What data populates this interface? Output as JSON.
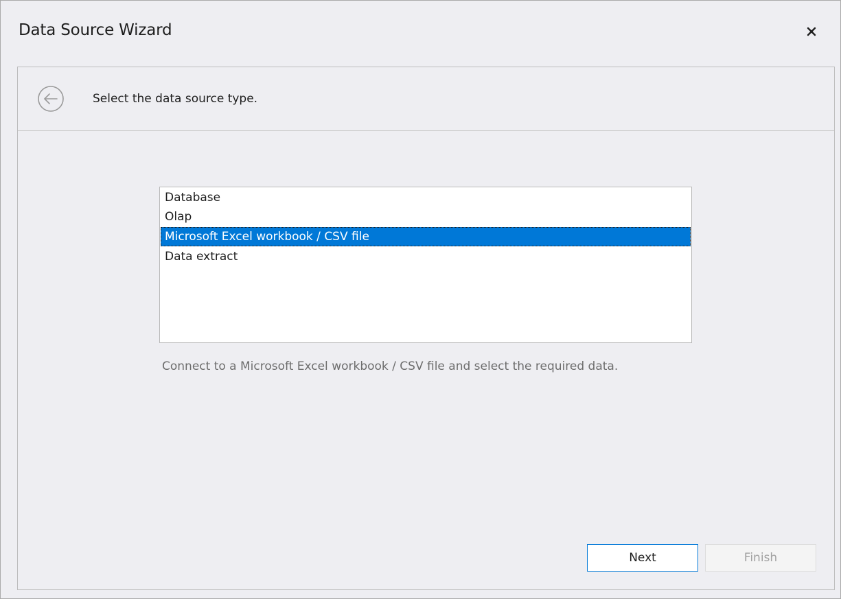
{
  "window": {
    "title": "Data Source Wizard"
  },
  "header": {
    "step_title": "Select the data source type."
  },
  "list": {
    "items": [
      {
        "label": "Database",
        "selected": false
      },
      {
        "label": "Olap",
        "selected": false
      },
      {
        "label": "Microsoft Excel workbook / CSV file",
        "selected": true
      },
      {
        "label": "Data extract",
        "selected": false
      }
    ]
  },
  "description": "Connect to a Microsoft Excel workbook / CSV file and select the required data.",
  "buttons": {
    "next_label": "Next",
    "finish_label": "Finish",
    "finish_enabled": false
  },
  "icons": {
    "close": "close-icon",
    "back": "back-arrow-icon"
  },
  "colors": {
    "selection": "#0078d7",
    "window_bg": "#eeeef2"
  }
}
